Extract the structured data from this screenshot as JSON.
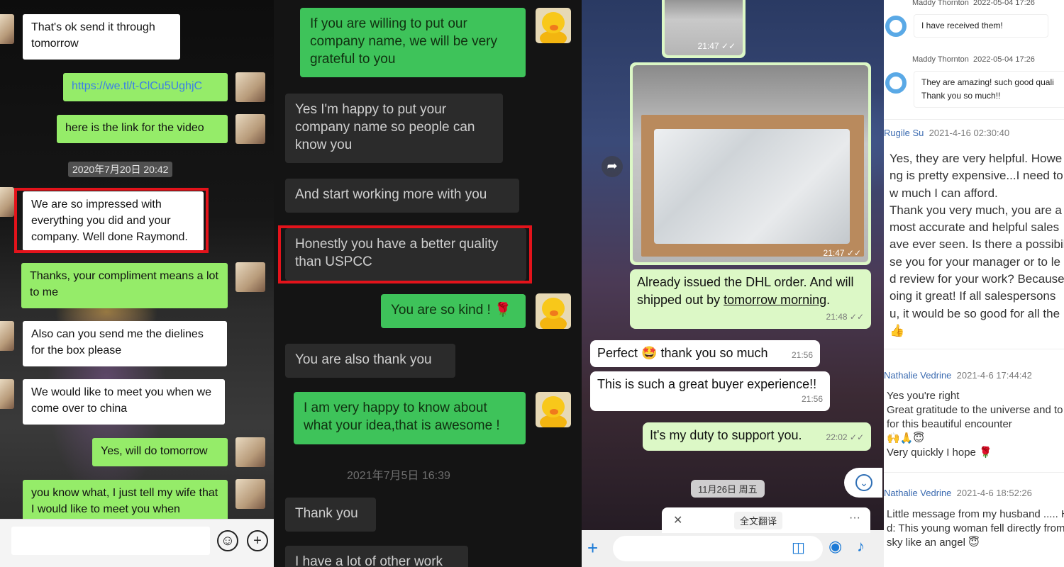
{
  "panel1": {
    "messages": [
      {
        "text": "That's ok send it through tomorrow"
      },
      {
        "text": "https://we.tl/t-ClCu5UghjC"
      },
      {
        "text": "here is the link for the video"
      },
      {
        "text": "We are so impressed with everything you did and your company. Well done Raymond."
      },
      {
        "text": "Thanks, your compliment means a lot to me"
      },
      {
        "text": "Also can you send me the dielines for the box please"
      },
      {
        "text": "We would like to meet you when we come over to china"
      },
      {
        "text": "Yes, will do tomorrow"
      },
      {
        "text": "you know what, I just tell my wife that I would like to meet you when"
      }
    ],
    "timestamp": "2020年7月20日 20:42",
    "emoji_icon": "smiley-face-icon",
    "plus_icon": "plus-circle-icon"
  },
  "panel2": {
    "messages": [
      {
        "text": "If you are willing to put our company name, we will be very grateful to you"
      },
      {
        "text": "Yes I'm happy to put your company name so people can know you"
      },
      {
        "text": "And start working more with you"
      },
      {
        "text": "Honestly you have a better quality than USPCC"
      },
      {
        "text": "You are so kind !"
      },
      {
        "text": "You are also thank you"
      },
      {
        "text": "I am very happy to know about what your idea,that is awesome !"
      },
      {
        "text": "Thank you"
      },
      {
        "text": "I have a lot of other work"
      }
    ],
    "timestamp": "2021年7月5日 16:39",
    "rose_emoji": "🌹"
  },
  "panel3": {
    "image_times": [
      "21:47",
      "21:47"
    ],
    "msg_dhl_prefix": "Already issued the DHL order. And will shipped out by ",
    "msg_dhl_link": "tomorrow morning",
    "msg_dhl_suffix": ".",
    "msg_dhl_time": "21:48",
    "msg_perfect": "Perfect 🤩 thank you so much",
    "msg_perfect_time": "21:56",
    "msg_great": "This is such a great buyer experience!!",
    "msg_great_time": "21:56",
    "msg_duty": "It's my duty to support you.",
    "msg_duty_time": "22:02",
    "date_chip": "11月26日 周五",
    "translate_label": "全文翻译",
    "translate_close": "✕",
    "translate_more": "···",
    "read_ticks": "✓✓"
  },
  "panel4": {
    "r1_name": "Maddy Thornton",
    "r1_date": "2022-05-04 17:26",
    "r1_text": "I have received them!",
    "r2_name": "Maddy Thornton",
    "r2_date": "2022-05-04 17:26",
    "r2_text_1": "They are amazing! such good quali",
    "r2_text_2": "Thank you so much!!",
    "r3_name": "Rugile Su",
    "r3_date": "2021-4-16 02:30:40",
    "r3_lines": [
      "Yes, they are very helpful. Howe",
      "ng is pretty expensive...I need to",
      "w much I can afford.",
      "Thank you very much, you are a",
      " most accurate and helpful sales",
      "ave ever seen. Is there a possibil",
      "se you for your manager or to le",
      "d review for your work? Because",
      "oing it great! If all salespersons",
      "u, it would be so good for all the"
    ],
    "r3_emoji": "👍",
    "r4_name": "Nathalie Vedrine",
    "r4_date": "2021-4-6 17:44:42",
    "r4_lines": [
      "Yes you're right",
      "Great gratitude to the universe and to",
      " for this beautiful encounter"
    ],
    "r4_emojis": "🙌🙏😇",
    "r4_last": "Very quickly I hope 🌹",
    "r5_name": "Nathalie Vedrine",
    "r5_date": "2021-4-6 18:52:26",
    "r5_lines": [
      "Little message from my husband ..... H",
      "d: This young woman fell directly from",
      "sky like an angel 😇"
    ]
  }
}
